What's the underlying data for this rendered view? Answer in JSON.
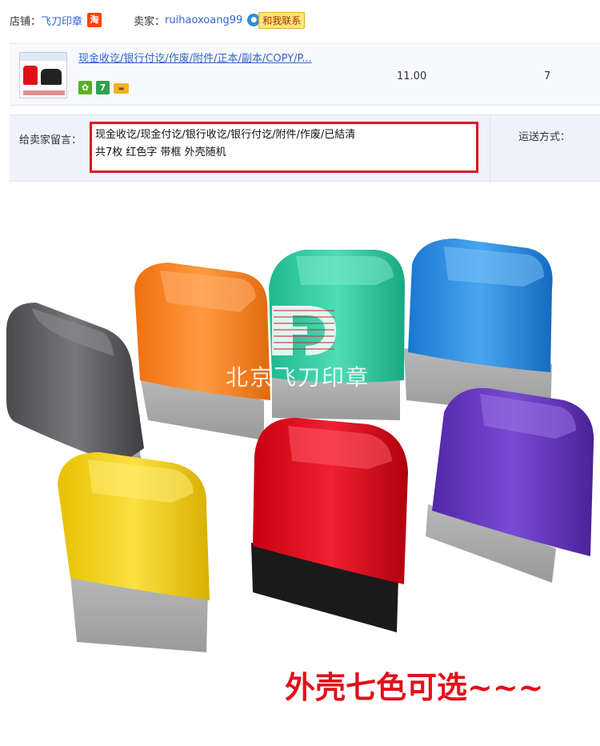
{
  "shop": {
    "shop_label": "店铺：",
    "shop_name": "飞刀印章",
    "tao_badge": "淘",
    "seller_label": "卖家：",
    "seller_name": "ruihaoxoang99",
    "contact_button": "和我联系",
    "contact_icon": "chat-bubble-icon"
  },
  "item": {
    "title": "现金收讫/银行付讫/作废/附件/正本/副本/COPY/P...",
    "price": "11.00",
    "quantity": "7",
    "service_icons": [
      "green-guarantee-icon",
      "seven-day-return-icon",
      "credit-card-icon"
    ],
    "service_glyphs": [
      "✿",
      "7",
      "▬"
    ]
  },
  "message": {
    "label": "给卖家留言：",
    "line1": "现金收讫/现金付讫/银行收讫/银行付讫/附件/作废/已結清",
    "line2": "共7枚  红色字  带框   外壳随机",
    "box_color": "#e01020"
  },
  "shipping": {
    "label": "运送方式："
  },
  "photo": {
    "watermark_text": "北京飞刀印章",
    "caption": "外壳七色可选~~~",
    "stamp_colors": {
      "gray": "#5a5a5e",
      "orange": "#ff8a2a",
      "teal": "#2fc8a0",
      "blue": "#2a8fe0",
      "yellow": "#f2d21a",
      "red": "#e0101a",
      "purple": "#6a3ac0"
    }
  }
}
